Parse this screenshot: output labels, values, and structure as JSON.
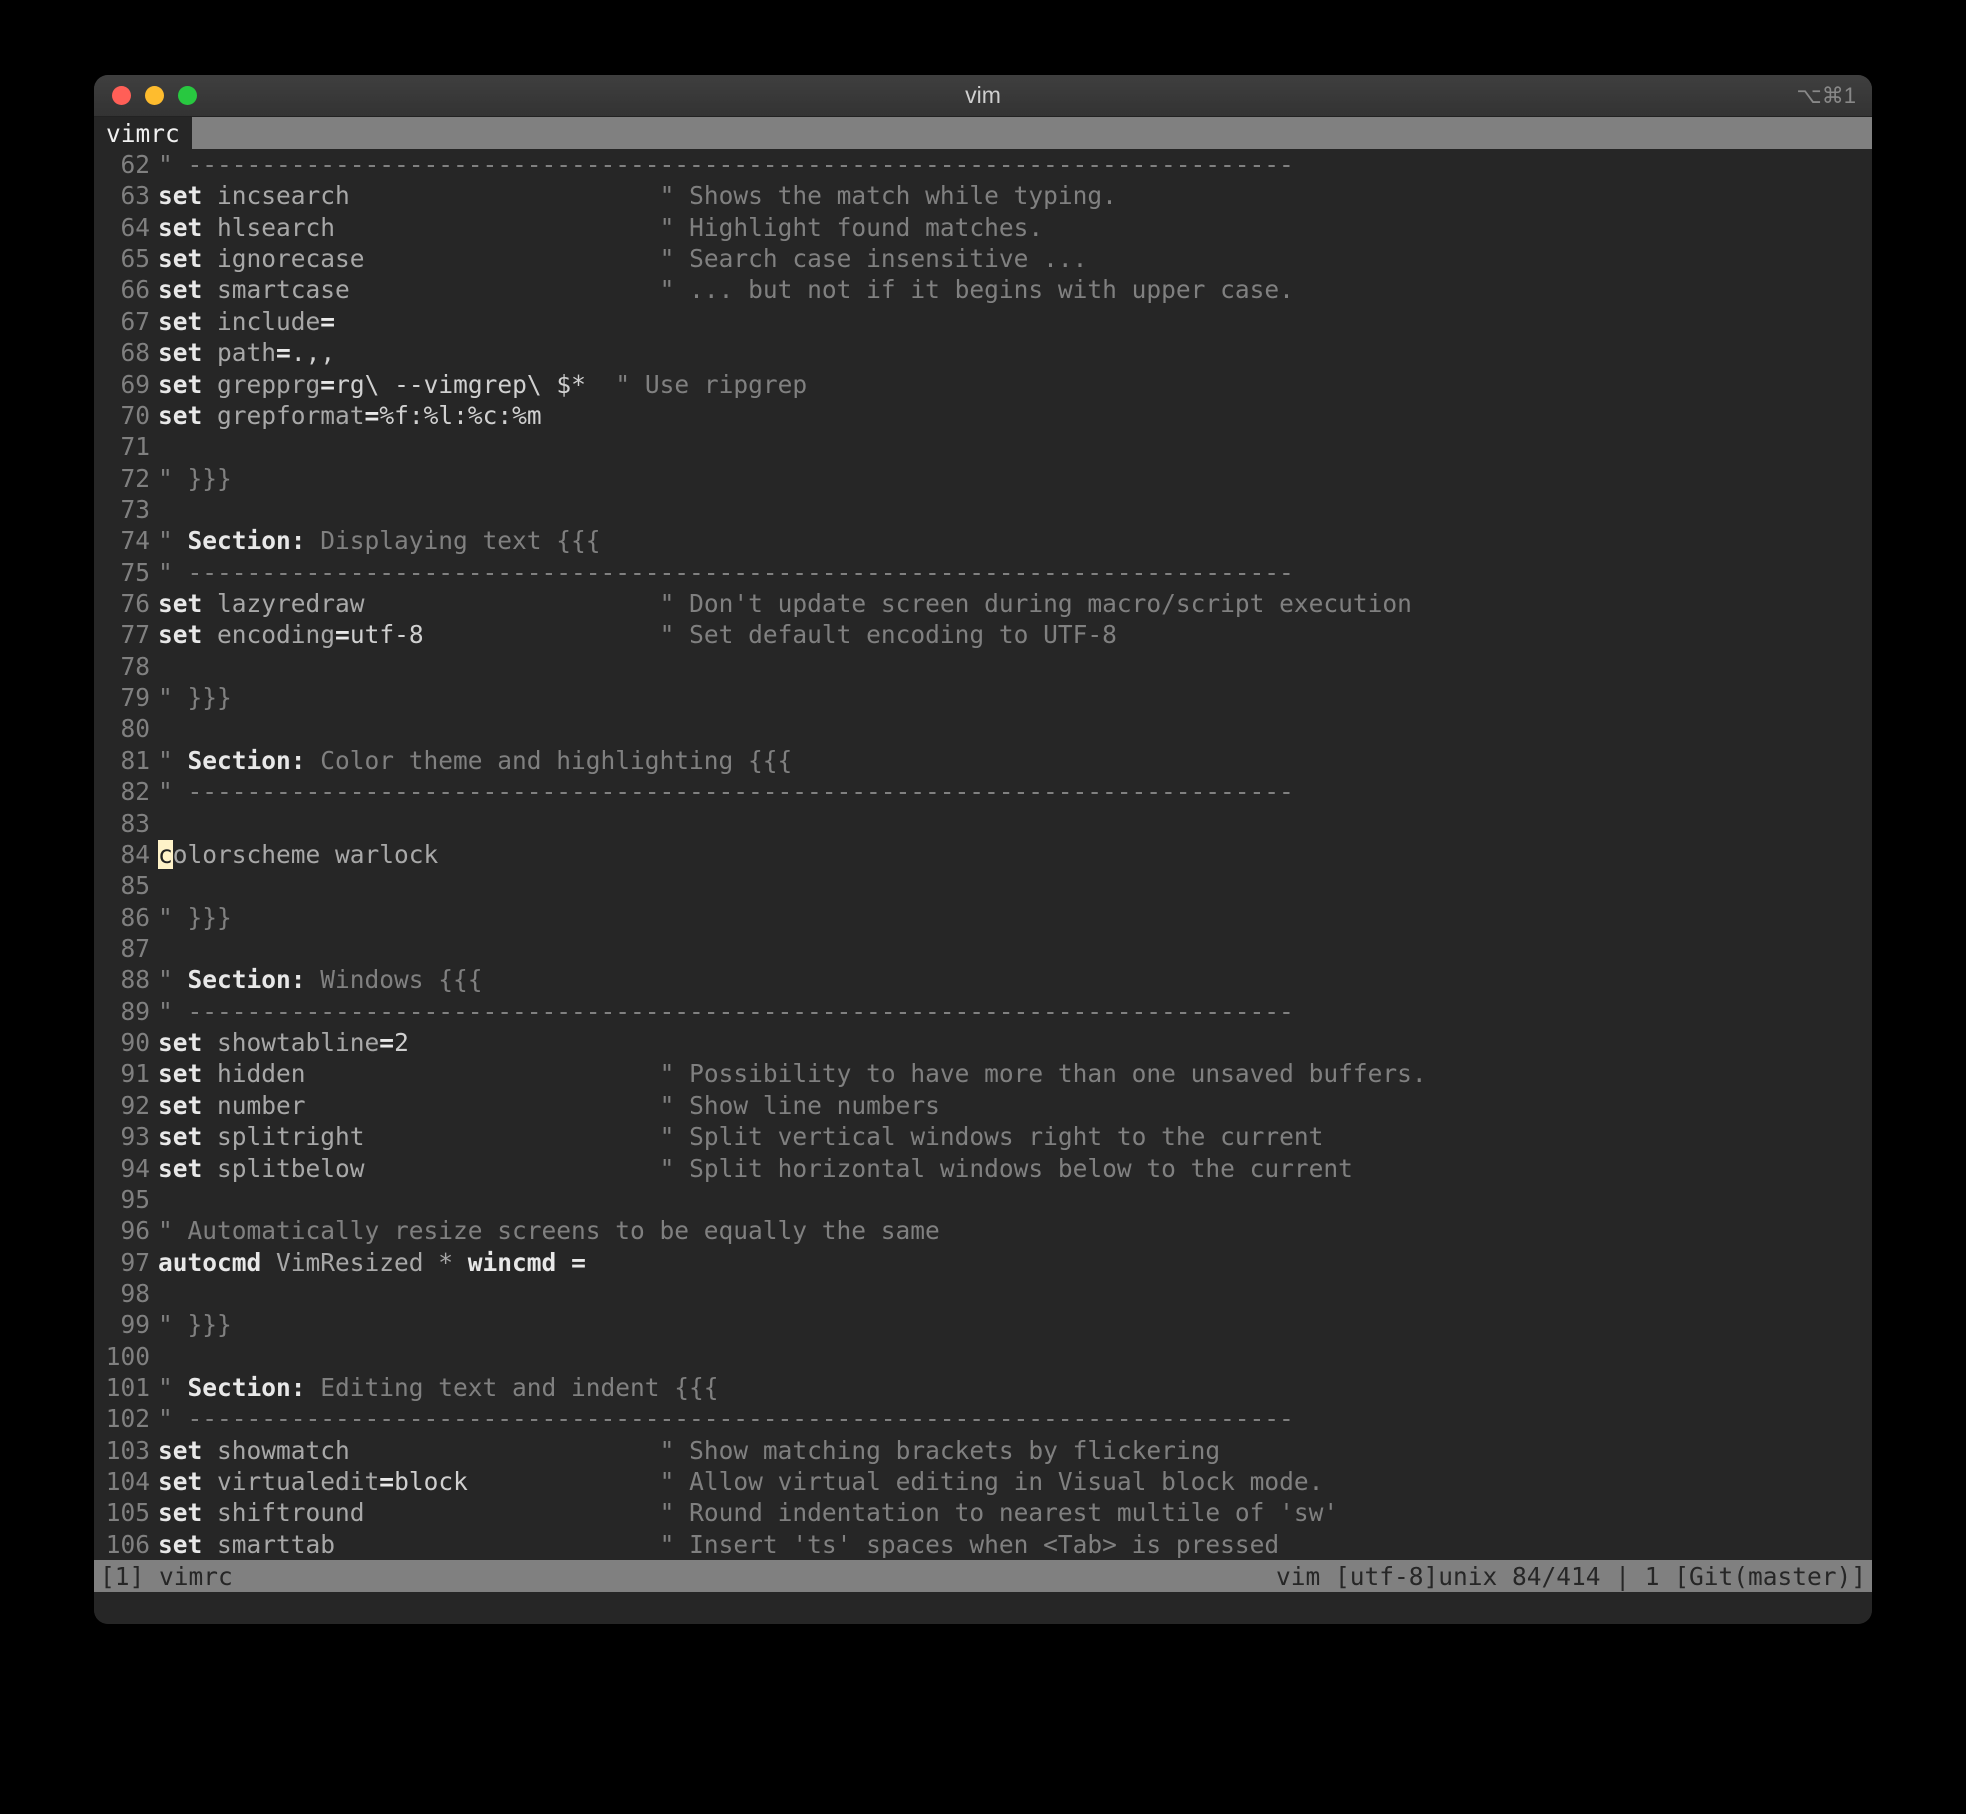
{
  "window": {
    "title": "vim",
    "shortcut_hint": "⌥⌘1"
  },
  "tabline": {
    "active_tab": " vimrc"
  },
  "gutter_start": 62,
  "lines": [
    {
      "n": 62,
      "seg": [
        {
          "c": "comment",
          "t": "\" ---------------------------------------------------------------------------"
        }
      ]
    },
    {
      "n": 63,
      "seg": [
        {
          "c": "stmt",
          "t": "set"
        },
        {
          "c": "",
          "t": " "
        },
        {
          "c": "ident",
          "t": "incsearch"
        },
        {
          "c": "",
          "t": "                     "
        },
        {
          "c": "comment",
          "t": "\" Shows the match while typing."
        }
      ]
    },
    {
      "n": 64,
      "seg": [
        {
          "c": "stmt",
          "t": "set"
        },
        {
          "c": "",
          "t": " "
        },
        {
          "c": "ident",
          "t": "hlsearch"
        },
        {
          "c": "",
          "t": "                      "
        },
        {
          "c": "comment",
          "t": "\" Highlight found matches."
        }
      ]
    },
    {
      "n": 65,
      "seg": [
        {
          "c": "stmt",
          "t": "set"
        },
        {
          "c": "",
          "t": " "
        },
        {
          "c": "ident",
          "t": "ignorecase"
        },
        {
          "c": "",
          "t": "                    "
        },
        {
          "c": "comment",
          "t": "\" Search case insensitive ..."
        }
      ]
    },
    {
      "n": 66,
      "seg": [
        {
          "c": "stmt",
          "t": "set"
        },
        {
          "c": "",
          "t": " "
        },
        {
          "c": "ident",
          "t": "smartcase"
        },
        {
          "c": "",
          "t": "                     "
        },
        {
          "c": "comment",
          "t": "\" ... but not if it begins with upper case."
        }
      ]
    },
    {
      "n": 67,
      "seg": [
        {
          "c": "stmt",
          "t": "set"
        },
        {
          "c": "",
          "t": " "
        },
        {
          "c": "ident",
          "t": "include"
        },
        {
          "c": "op",
          "t": "="
        }
      ]
    },
    {
      "n": 68,
      "seg": [
        {
          "c": "stmt",
          "t": "set"
        },
        {
          "c": "",
          "t": " "
        },
        {
          "c": "ident",
          "t": "path"
        },
        {
          "c": "op",
          "t": "="
        },
        {
          "c": "val",
          "t": ".,,"
        }
      ]
    },
    {
      "n": 69,
      "seg": [
        {
          "c": "stmt",
          "t": "set"
        },
        {
          "c": "",
          "t": " "
        },
        {
          "c": "ident",
          "t": "grepprg"
        },
        {
          "c": "op",
          "t": "="
        },
        {
          "c": "val",
          "t": "rg\\ --vimgrep\\ $*"
        },
        {
          "c": "",
          "t": "  "
        },
        {
          "c": "comment",
          "t": "\" Use ripgrep"
        }
      ]
    },
    {
      "n": 70,
      "seg": [
        {
          "c": "stmt",
          "t": "set"
        },
        {
          "c": "",
          "t": " "
        },
        {
          "c": "ident",
          "t": "grepformat"
        },
        {
          "c": "op",
          "t": "="
        },
        {
          "c": "val",
          "t": "%f:%l:%c:%m"
        }
      ]
    },
    {
      "n": 71,
      "seg": []
    },
    {
      "n": 72,
      "seg": [
        {
          "c": "comment",
          "t": "\" }}}"
        }
      ]
    },
    {
      "n": 73,
      "seg": []
    },
    {
      "n": 74,
      "seg": [
        {
          "c": "comment",
          "t": "\" "
        },
        {
          "c": "stmt",
          "t": "Section:"
        },
        {
          "c": "comment",
          "t": " Displaying text {{{"
        }
      ]
    },
    {
      "n": 75,
      "seg": [
        {
          "c": "comment",
          "t": "\" ---------------------------------------------------------------------------"
        }
      ]
    },
    {
      "n": 76,
      "seg": [
        {
          "c": "stmt",
          "t": "set"
        },
        {
          "c": "",
          "t": " "
        },
        {
          "c": "ident",
          "t": "lazyredraw"
        },
        {
          "c": "",
          "t": "                    "
        },
        {
          "c": "comment",
          "t": "\" Don't update screen during macro/script execution"
        }
      ]
    },
    {
      "n": 77,
      "seg": [
        {
          "c": "stmt",
          "t": "set"
        },
        {
          "c": "",
          "t": " "
        },
        {
          "c": "ident",
          "t": "encoding"
        },
        {
          "c": "op",
          "t": "="
        },
        {
          "c": "val",
          "t": "utf-8"
        },
        {
          "c": "",
          "t": "                "
        },
        {
          "c": "comment",
          "t": "\" Set default encoding to UTF-8"
        }
      ]
    },
    {
      "n": 78,
      "seg": []
    },
    {
      "n": 79,
      "seg": [
        {
          "c": "comment",
          "t": "\" }}}"
        }
      ]
    },
    {
      "n": 80,
      "seg": []
    },
    {
      "n": 81,
      "seg": [
        {
          "c": "comment",
          "t": "\" "
        },
        {
          "c": "stmt",
          "t": "Section:"
        },
        {
          "c": "comment",
          "t": " Color theme and highlighting {{{"
        }
      ]
    },
    {
      "n": 82,
      "seg": [
        {
          "c": "comment",
          "t": "\" ---------------------------------------------------------------------------"
        }
      ]
    },
    {
      "n": 83,
      "seg": []
    },
    {
      "n": 84,
      "seg": [
        {
          "c": "cursor",
          "t": "c"
        },
        {
          "c": "ident",
          "t": "olorscheme warlock"
        }
      ]
    },
    {
      "n": 85,
      "seg": []
    },
    {
      "n": 86,
      "seg": [
        {
          "c": "comment",
          "t": "\" }}}"
        }
      ]
    },
    {
      "n": 87,
      "seg": []
    },
    {
      "n": 88,
      "seg": [
        {
          "c": "comment",
          "t": "\" "
        },
        {
          "c": "stmt",
          "t": "Section:"
        },
        {
          "c": "comment",
          "t": " Windows {{{"
        }
      ]
    },
    {
      "n": 89,
      "seg": [
        {
          "c": "comment",
          "t": "\" ---------------------------------------------------------------------------"
        }
      ]
    },
    {
      "n": 90,
      "seg": [
        {
          "c": "stmt",
          "t": "set"
        },
        {
          "c": "",
          "t": " "
        },
        {
          "c": "ident",
          "t": "showtabline"
        },
        {
          "c": "op",
          "t": "="
        },
        {
          "c": "val",
          "t": "2"
        }
      ]
    },
    {
      "n": 91,
      "seg": [
        {
          "c": "stmt",
          "t": "set"
        },
        {
          "c": "",
          "t": " "
        },
        {
          "c": "ident",
          "t": "hidden"
        },
        {
          "c": "",
          "t": "                        "
        },
        {
          "c": "comment",
          "t": "\" Possibility to have more than one unsaved buffers."
        }
      ]
    },
    {
      "n": 92,
      "seg": [
        {
          "c": "stmt",
          "t": "set"
        },
        {
          "c": "",
          "t": " "
        },
        {
          "c": "ident",
          "t": "number"
        },
        {
          "c": "",
          "t": "                        "
        },
        {
          "c": "comment",
          "t": "\" Show line numbers"
        }
      ]
    },
    {
      "n": 93,
      "seg": [
        {
          "c": "stmt",
          "t": "set"
        },
        {
          "c": "",
          "t": " "
        },
        {
          "c": "ident",
          "t": "splitright"
        },
        {
          "c": "",
          "t": "                    "
        },
        {
          "c": "comment",
          "t": "\" Split vertical windows right to the current"
        }
      ]
    },
    {
      "n": 94,
      "seg": [
        {
          "c": "stmt",
          "t": "set"
        },
        {
          "c": "",
          "t": " "
        },
        {
          "c": "ident",
          "t": "splitbelow"
        },
        {
          "c": "",
          "t": "                    "
        },
        {
          "c": "comment",
          "t": "\" Split horizontal windows below to the current"
        }
      ]
    },
    {
      "n": 95,
      "seg": []
    },
    {
      "n": 96,
      "seg": [
        {
          "c": "comment",
          "t": "\" Automatically resize screens to be equally the same"
        }
      ]
    },
    {
      "n": 97,
      "seg": [
        {
          "c": "stmt",
          "t": "autocmd"
        },
        {
          "c": "",
          "t": " "
        },
        {
          "c": "ident",
          "t": "VimResized * "
        },
        {
          "c": "stmt",
          "t": "wincmd"
        },
        {
          "c": "",
          "t": " "
        },
        {
          "c": "op",
          "t": "="
        }
      ]
    },
    {
      "n": 98,
      "seg": []
    },
    {
      "n": 99,
      "seg": [
        {
          "c": "comment",
          "t": "\" }}}"
        }
      ]
    },
    {
      "n": 100,
      "seg": []
    },
    {
      "n": 101,
      "seg": [
        {
          "c": "comment",
          "t": "\" "
        },
        {
          "c": "stmt",
          "t": "Section:"
        },
        {
          "c": "comment",
          "t": " Editing text and indent {{{"
        }
      ]
    },
    {
      "n": 102,
      "seg": [
        {
          "c": "comment",
          "t": "\" ---------------------------------------------------------------------------"
        }
      ]
    },
    {
      "n": 103,
      "seg": [
        {
          "c": "stmt",
          "t": "set"
        },
        {
          "c": "",
          "t": " "
        },
        {
          "c": "ident",
          "t": "showmatch"
        },
        {
          "c": "",
          "t": "                     "
        },
        {
          "c": "comment",
          "t": "\" Show matching brackets by flickering"
        }
      ]
    },
    {
      "n": 104,
      "seg": [
        {
          "c": "stmt",
          "t": "set"
        },
        {
          "c": "",
          "t": " "
        },
        {
          "c": "ident",
          "t": "virtualedit"
        },
        {
          "c": "op",
          "t": "="
        },
        {
          "c": "val",
          "t": "block"
        },
        {
          "c": "",
          "t": "             "
        },
        {
          "c": "comment",
          "t": "\" Allow virtual editing in Visual block mode."
        }
      ]
    },
    {
      "n": 105,
      "seg": [
        {
          "c": "stmt",
          "t": "set"
        },
        {
          "c": "",
          "t": " "
        },
        {
          "c": "ident",
          "t": "shiftround"
        },
        {
          "c": "",
          "t": "                    "
        },
        {
          "c": "comment",
          "t": "\" Round indentation to nearest multile of 'sw'"
        }
      ]
    },
    {
      "n": 106,
      "seg": [
        {
          "c": "stmt",
          "t": "set"
        },
        {
          "c": "",
          "t": " "
        },
        {
          "c": "ident",
          "t": "smarttab"
        },
        {
          "c": "",
          "t": "                      "
        },
        {
          "c": "comment",
          "t": "\" Insert 'ts' spaces when <Tab> is pressed"
        }
      ]
    }
  ],
  "statusline": {
    "left": "[1]  vimrc",
    "right": "vim  [utf-8]unix  84/414 | 1  [Git(master)]"
  }
}
